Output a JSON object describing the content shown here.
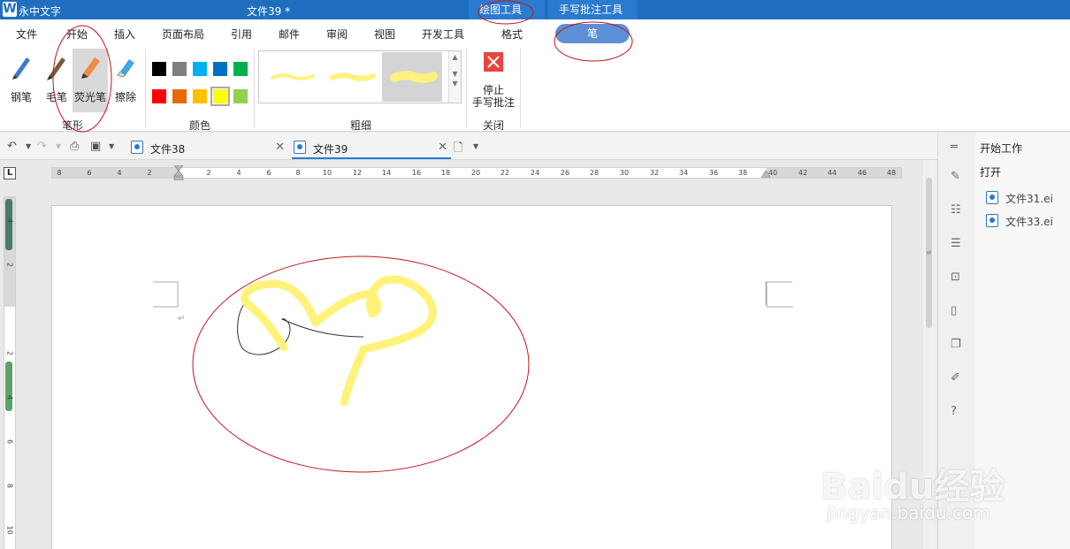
{
  "titlebar": {
    "logo": "W",
    "app_name": "永中文字",
    "doc_title": "文件39 *",
    "context_tabs": [
      "绘图工具",
      "手写批注工具"
    ]
  },
  "menu": {
    "items": [
      "文件",
      "开始",
      "插入",
      "页面布局",
      "引用",
      "邮件",
      "审阅",
      "视图",
      "开发工具",
      "格式"
    ],
    "active_tab": "笔"
  },
  "ribbon": {
    "pen_group": {
      "label": "笔形",
      "pens": [
        "钢笔",
        "毛笔",
        "荧光笔",
        "擦除"
      ],
      "selected": "荧光笔"
    },
    "color_group": {
      "label": "颜色",
      "colors": [
        "#000000",
        "#7f7f7f",
        "#00b0f0",
        "#0070c0",
        "#00b050",
        "#ff0000",
        "#e36c09",
        "#ffc000",
        "#ffff00",
        "#92d050"
      ],
      "selected": "#ffff00"
    },
    "thickness_group": {
      "label": "粗细"
    },
    "close_group": {
      "label": "关闭",
      "stop_label_1": "停止",
      "stop_label_2": "手写批注"
    }
  },
  "quickbar": {
    "tabs": [
      {
        "name": "文件38",
        "active": false
      },
      {
        "name": "文件39",
        "active": true
      }
    ]
  },
  "ruler": {
    "h_ticks": [
      "8",
      "6",
      "4",
      "2",
      "2",
      "4",
      "6",
      "8",
      "10",
      "12",
      "14",
      "16",
      "18",
      "20",
      "22",
      "24",
      "26",
      "28",
      "30",
      "32",
      "34",
      "36",
      "38",
      "40",
      "42",
      "44",
      "46",
      "48"
    ],
    "v_ticks": [
      "4",
      "2",
      "2",
      "4",
      "6",
      "8",
      "10"
    ],
    "corner": "L"
  },
  "right_panel": {
    "title": "开始工作",
    "open_label": "打开",
    "files": [
      "文件31.ei",
      "文件33.ei"
    ]
  },
  "watermark": {
    "brand": "Baidu经验",
    "url": "jingyan.baidu.com"
  },
  "colors": {
    "title_blue": "#1f6ebf",
    "pen_tab_blue": "#5d8fd6",
    "highlighter_yellow": "#fff27a",
    "annotation_red": "#c4141b"
  }
}
